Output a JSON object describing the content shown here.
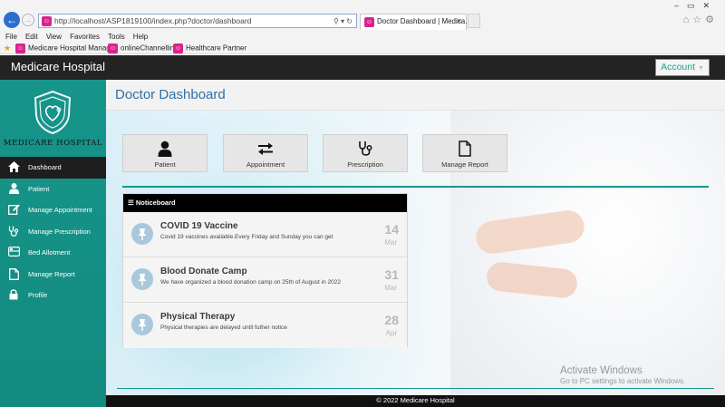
{
  "browser": {
    "url": "http://localhost/ASP1819100/index.php?doctor/dashboard",
    "tab_title": "Doctor Dashboard | Medica...",
    "menu": [
      "File",
      "Edit",
      "View",
      "Favorites",
      "Tools",
      "Help"
    ],
    "favorites": [
      "Medicare Hospital Manag...",
      "onlineChannelling",
      "Healthcare Partner"
    ]
  },
  "header": {
    "brand": "Medicare Hospital",
    "account_label": "Account"
  },
  "sidebar": {
    "logo_text": "MEDICARE HOSPITAL",
    "items": [
      {
        "label": "Dashboard",
        "icon": "home-icon",
        "active": true
      },
      {
        "label": "Patient",
        "icon": "user-icon",
        "active": false
      },
      {
        "label": "Manage Appointment",
        "icon": "edit-icon",
        "active": false
      },
      {
        "label": "Manage Prescription",
        "icon": "stethoscope-icon",
        "active": false
      },
      {
        "label": "Bed Allotment",
        "icon": "bed-icon",
        "active": false
      },
      {
        "label": "Manage Report",
        "icon": "file-icon",
        "active": false
      },
      {
        "label": "Profile",
        "icon": "lock-icon",
        "active": false
      }
    ]
  },
  "main": {
    "page_title": "Doctor Dashboard",
    "quick_links": [
      {
        "label": "Patient",
        "icon": "user-icon"
      },
      {
        "label": "Appointment",
        "icon": "exchange-icon"
      },
      {
        "label": "Prescription",
        "icon": "stethoscope-icon"
      },
      {
        "label": "Manage Report",
        "icon": "file-icon"
      }
    ],
    "noticeboard": {
      "title": "Noticeboard",
      "items": [
        {
          "title": "COVID 19 Vaccine",
          "desc": "Covid 19 vaccines available.Every Friday and Sunday you can get",
          "day": "14",
          "month": "Mar"
        },
        {
          "title": "Blood Donate Camp",
          "desc": "We have organized a blood donation camp on 25th of August in 2022",
          "day": "31",
          "month": "Mar"
        },
        {
          "title": "Physical Therapy",
          "desc": "Physical therapies are delayed until futher notice",
          "day": "28",
          "month": "Apr"
        }
      ]
    },
    "watermark": {
      "line1": "Activate Windows",
      "line2": "Go to PC settings to activate Windows."
    },
    "footer": "© 2022 Medicare Hospital"
  },
  "colors": {
    "accent": "#12998d",
    "title_blue": "#2f6fa8",
    "topbar": "#232323"
  }
}
